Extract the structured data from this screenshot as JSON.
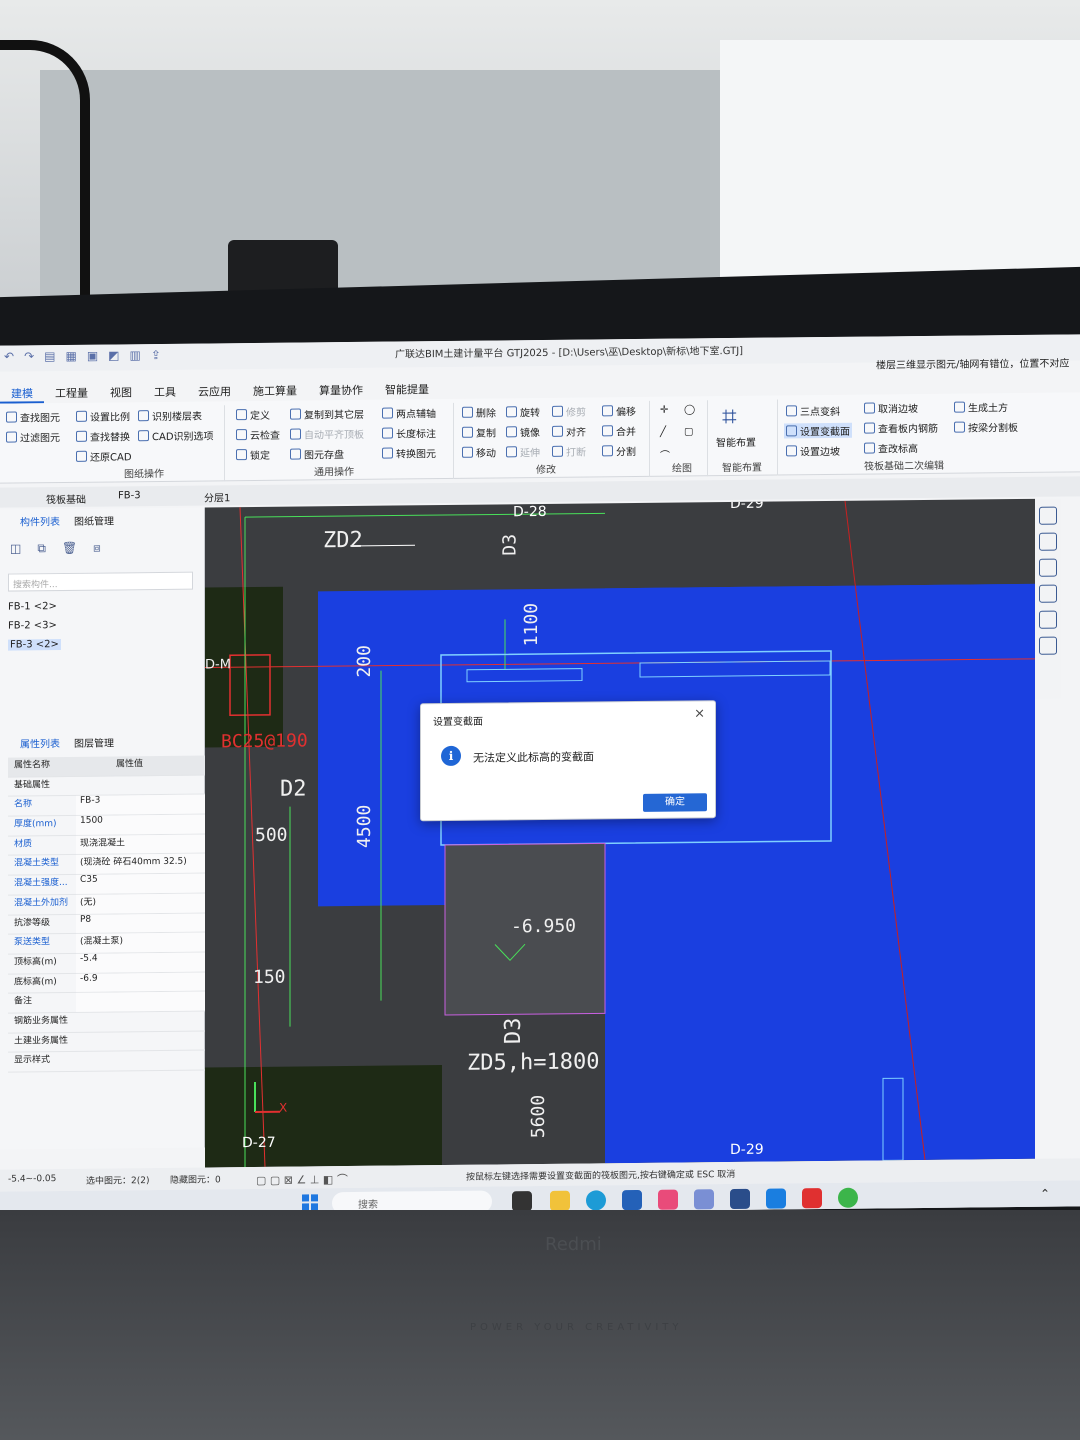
{
  "window": {
    "title": "广联达BIM土建计量平台 GTJ2025 - [D:\\Users\\巫\\Desktop\\新标\\地下室.GTJ]",
    "top_hint": "楼层三维显示图元/轴网有错位，位置不对应"
  },
  "menu": [
    "建模",
    "工程量",
    "视图",
    "工具",
    "云应用",
    "施工算量",
    "算量协作",
    "智能提量"
  ],
  "ribbon": {
    "drawing_ops": {
      "items": [
        "查找图元",
        "过滤图元",
        "设置比例",
        "查找替换",
        "还原CAD",
        "识别楼层表",
        "CAD识别选项"
      ],
      "label": "图纸操作"
    },
    "common_ops": {
      "items": [
        "定义",
        "云检查",
        "锁定",
        "复制到其它层",
        "自动平齐顶板",
        "图元存盘",
        "两点辅轴",
        "长度标注",
        "转换图元"
      ],
      "label": "通用操作"
    },
    "modify": {
      "items": [
        "删除",
        "复制",
        "移动",
        "旋转",
        "镜像",
        "延伸",
        "修剪",
        "对齐",
        "打断",
        "偏移",
        "合并",
        "分割"
      ],
      "label": "修改"
    },
    "draw": {
      "label": "绘图"
    },
    "smart": {
      "button": "智能布置",
      "label": "智能布置"
    },
    "raft": {
      "items": [
        "三点变斜",
        "设置变截面",
        "设置边坡",
        "取消边坡",
        "查看板内钢筋",
        "查改标高",
        "生成土方",
        "按梁分割板"
      ],
      "label": "筏板基础二次编辑"
    }
  },
  "selectors": [
    "筏板基础",
    "FB-3",
    "分层1"
  ],
  "component_panel": {
    "tabs": [
      "构件列表",
      "图纸管理"
    ],
    "search_placeholder": "搜索构件...",
    "items": [
      "FB-1 <2>",
      "FB-2 <3>",
      "FB-3 <2>"
    ],
    "selected_index": 2
  },
  "property_panel": {
    "tabs": [
      "属性列表",
      "图层管理"
    ],
    "columns": [
      "属性名称",
      "属性值"
    ],
    "group": "基础属性",
    "rows": [
      {
        "name": "名称",
        "value": "FB-3"
      },
      {
        "name": "厚度(mm)",
        "value": "1500"
      },
      {
        "name": "材质",
        "value": "现浇混凝土"
      },
      {
        "name": "混凝土类型",
        "value": "(现浇砼 碎石40mm 32.5)"
      },
      {
        "name": "混凝土强度...",
        "value": "C35"
      },
      {
        "name": "混凝土外加剂",
        "value": "(无)"
      },
      {
        "name": "抗渗等级",
        "value": "P8"
      },
      {
        "name": "泵送类型",
        "value": "(混凝土泵)"
      },
      {
        "name": "顶标高(m)",
        "value": "-5.4"
      },
      {
        "name": "底标高(m)",
        "value": "-6.9"
      },
      {
        "name": "备注",
        "value": ""
      }
    ],
    "collapsed_groups": [
      "钢筋业务属性",
      "土建业务属性",
      "显示样式"
    ]
  },
  "canvas": {
    "labels": {
      "zd2": "ZD2",
      "d3_top": "D3",
      "dim_1100": "1100",
      "dim_200": "200",
      "dm": "D-M",
      "bc": "BC25@190",
      "d2": "D2",
      "dim_500": "500",
      "dim_4500": "4500",
      "elev": "-6.950",
      "dim_150": "150",
      "d3_bottom": "D3",
      "zd5": "ZD5,h=1800",
      "dim_5600": "5600"
    },
    "axes": {
      "d28": "D-28",
      "d29_top": "D-29",
      "d29_bottom": "D-29",
      "d27": "D-27",
      "x": "X"
    },
    "colors": {
      "slab": "#1a3fe0",
      "background": "#3b3d40",
      "grid_red": "#e23030",
      "dim_green": "#49e05a"
    }
  },
  "dialog": {
    "title": "设置变截面",
    "message": "无法定义此标高的变截面",
    "ok": "确定",
    "close": "×"
  },
  "status": {
    "elevation": "-5.4~-0.05",
    "selected": "选中图元：2(2)",
    "hidden": "隐藏图元：0",
    "hint": "按鼠标左键选择需要设置变截面的筏板图元,按右键确定或 ESC 取消"
  },
  "taskbar": {
    "search": "搜索"
  },
  "device": {
    "brand": "Redmi",
    "tagline": "POWER YOUR CREATIVITY"
  }
}
